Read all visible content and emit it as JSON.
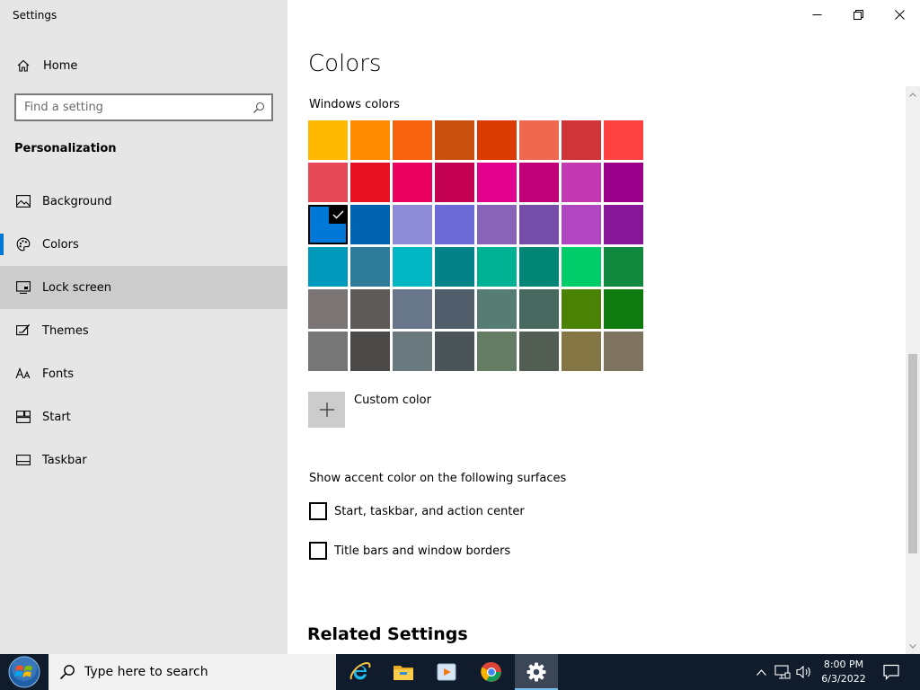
{
  "app": {
    "title": "Settings"
  },
  "sidebar": {
    "home_label": "Home",
    "search_placeholder": "Find a setting",
    "section": "Personalization",
    "items": [
      {
        "label": "Background",
        "icon": "image-icon"
      },
      {
        "label": "Colors",
        "icon": "palette-icon",
        "selected": true
      },
      {
        "label": "Lock screen",
        "icon": "lock-screen-icon",
        "hovered": true
      },
      {
        "label": "Themes",
        "icon": "themes-icon"
      },
      {
        "label": "Fonts",
        "icon": "fonts-icon"
      },
      {
        "label": "Start",
        "icon": "start-icon"
      },
      {
        "label": "Taskbar",
        "icon": "taskbar-icon"
      }
    ]
  },
  "main": {
    "title": "Colors",
    "windows_colors_label": "Windows colors",
    "swatches": [
      "#ffb900",
      "#ff8c00",
      "#f7630c",
      "#ca5010",
      "#da3b01",
      "#ef6950",
      "#d13438",
      "#ff4343",
      "#e74856",
      "#e81123",
      "#ea005e",
      "#c30052",
      "#e3008c",
      "#bf0077",
      "#c239b3",
      "#9a0089",
      "#0078d7",
      "#0063b1",
      "#8e8cd8",
      "#6b69d6",
      "#8764b8",
      "#744da9",
      "#b146c2",
      "#881798",
      "#0099bc",
      "#2d7d9a",
      "#00b7c3",
      "#038387",
      "#00b294",
      "#018574",
      "#00cc6a",
      "#10893e",
      "#7a7574",
      "#5d5a58",
      "#68768a",
      "#515c6b",
      "#567c73",
      "#486860",
      "#498205",
      "#107c10",
      "#767676",
      "#4c4a48",
      "#69797e",
      "#4a5459",
      "#647c64",
      "#525e54",
      "#847545",
      "#7e735f"
    ],
    "selected_swatch": 16,
    "custom_color_label": "Custom color",
    "surfaces_heading": "Show accent color on the following surfaces",
    "checkboxes": [
      {
        "label": "Start, taskbar, and action center",
        "checked": false
      },
      {
        "label": "Title bars and window borders",
        "checked": false
      }
    ],
    "related_heading": "Related Settings"
  },
  "taskbar": {
    "search_placeholder": "Type here to search",
    "apps": [
      "internet-explorer-icon",
      "file-explorer-icon",
      "media-player-icon",
      "chrome-icon",
      "settings-gear-icon"
    ],
    "time": "8:00 PM",
    "date": "6/3/2022"
  }
}
